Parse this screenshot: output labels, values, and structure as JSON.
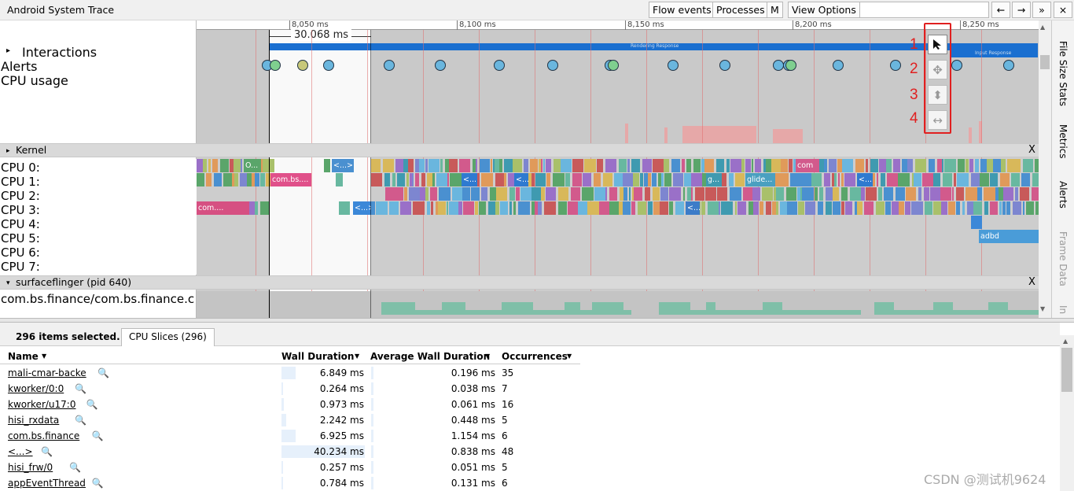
{
  "app": {
    "title": "Android System Trace"
  },
  "toolbar": {
    "flow_events": "Flow events",
    "processes": "Processes",
    "m": "M",
    "view_options": "View Options",
    "prev": "←",
    "next": "→",
    "more": "»",
    "close": "×"
  },
  "ruler": {
    "ticks": [
      "8,050 ms",
      "8,100 ms",
      "8,150 ms",
      "8,200 ms",
      "8,250 ms"
    ],
    "span": "30.068 ms"
  },
  "tracks": {
    "interactions": "Interactions",
    "alerts": "Alerts",
    "cpu_usage": "CPU usage",
    "kernel": "Kernel",
    "cpus": [
      "CPU 0:",
      "CPU 1:",
      "CPU 2:",
      "CPU 3:",
      "CPU 4:",
      "CPU 5:",
      "CPU 6:",
      "CPU 7:"
    ],
    "surfaceflinger": "surfaceflinger (pid 640)",
    "process_name": "com.bs.finance/com.bs.finance.c",
    "close_x": "X",
    "rendering_response": "Rendering Response",
    "input_response": "Input Response"
  },
  "slices": {
    "cpu0_a": "O...",
    "cpu0_b": "<...>",
    "cpu0_c": "com",
    "cpu1_a": "com.bs....",
    "cpu1_b": "<...",
    "cpu1_c": "<...",
    "cpu1_d": "g...",
    "cpu1_e": "glide...",
    "cpu1_f": "<...",
    "cpu3_a": "com....",
    "cpu3_b": "<...>",
    "cpu3_c": "<...",
    "cpu5_a": "adbd"
  },
  "side_tabs": [
    "File Size Stats",
    "Metrics",
    "Alerts",
    "Frame Data",
    "In"
  ],
  "annotations": [
    "1",
    "2",
    "3",
    "4"
  ],
  "tools": [
    "select-tool",
    "pan-tool",
    "zoom-tool",
    "timing-tool"
  ],
  "selection": {
    "summary": "296 items selected.",
    "tab": "CPU Slices (296)",
    "columns": {
      "name": "Name",
      "wall": "Wall Duration",
      "avg": "Average Wall Duration",
      "occ": "Occurrences"
    },
    "rows": [
      {
        "name": "mali-cmar-backe",
        "wall": "6.849 ms",
        "avg": "0.196 ms",
        "occ": "35",
        "frac": 0.17
      },
      {
        "name": "kworker/0:0",
        "wall": "0.264 ms",
        "avg": "0.038 ms",
        "occ": "7",
        "frac": 0.007
      },
      {
        "name": "kworker/u17:0",
        "wall": "0.973 ms",
        "avg": "0.061 ms",
        "occ": "16",
        "frac": 0.024
      },
      {
        "name": "hisi_rxdata",
        "wall": "2.242 ms",
        "avg": "0.448 ms",
        "occ": "5",
        "frac": 0.056
      },
      {
        "name": "com.bs.finance",
        "wall": "6.925 ms",
        "avg": "1.154 ms",
        "occ": "6",
        "frac": 0.172
      },
      {
        "name": "<...>",
        "wall": "40.234 ms",
        "avg": "0.838 ms",
        "occ": "48",
        "frac": 1.0
      },
      {
        "name": "hisi_frw/0",
        "wall": "0.257 ms",
        "avg": "0.051 ms",
        "occ": "5",
        "frac": 0.006
      },
      {
        "name": "appEventThread",
        "wall": "0.784 ms",
        "avg": "0.131 ms",
        "occ": "6",
        "frac": 0.019
      }
    ]
  },
  "watermark": "CSDN @测试机9624"
}
